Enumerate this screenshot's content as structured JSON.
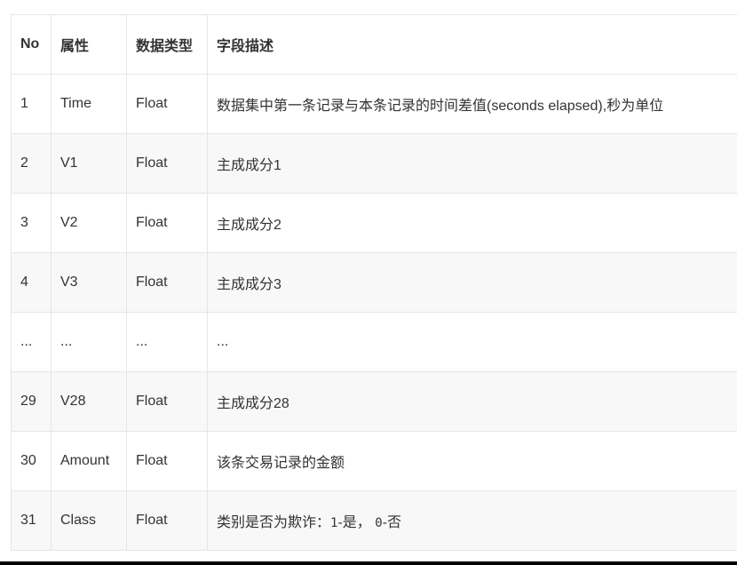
{
  "table": {
    "headers": [
      "No",
      "属性",
      "数据类型",
      "字段描述"
    ],
    "rows": [
      [
        "1",
        "Time",
        "Float",
        "数据集中第一条记录与本条记录的时间差值(seconds elapsed),秒为单位"
      ],
      [
        "2",
        "V1",
        "Float",
        "主成成分1"
      ],
      [
        "3",
        "V2",
        "Float",
        "主成成分2"
      ],
      [
        "4",
        "V3",
        "Float",
        "主成成分3"
      ],
      [
        "...",
        "...",
        "...",
        "..."
      ],
      [
        "29",
        "V28",
        "Float",
        "主成成分28"
      ],
      [
        "30",
        "Amount",
        "Float",
        "该条交易记录的金额"
      ]
    ],
    "last_row": {
      "no": "31",
      "attr": "Class",
      "type": "Float",
      "desc_prefix": "类别是否为欺诈：",
      "code1": "1",
      "label1": "-是，",
      "code0": "0",
      "label0": "-否"
    }
  }
}
